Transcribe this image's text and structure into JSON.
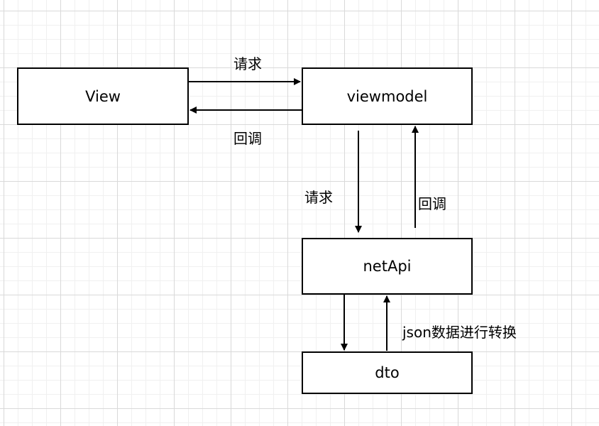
{
  "nodes": {
    "view": "View",
    "viewmodel": "viewmodel",
    "netapi": "netApi",
    "dto": "dto"
  },
  "edges": {
    "view_to_viewmodel": "请求",
    "viewmodel_to_view": "回调",
    "viewmodel_to_netapi": "请求",
    "netapi_to_viewmodel": "回调",
    "dto_to_netapi": "json数据进行转换"
  },
  "colors": {
    "stroke": "#000000",
    "box_fill": "#ffffff",
    "grid": "#d9d9d9"
  }
}
